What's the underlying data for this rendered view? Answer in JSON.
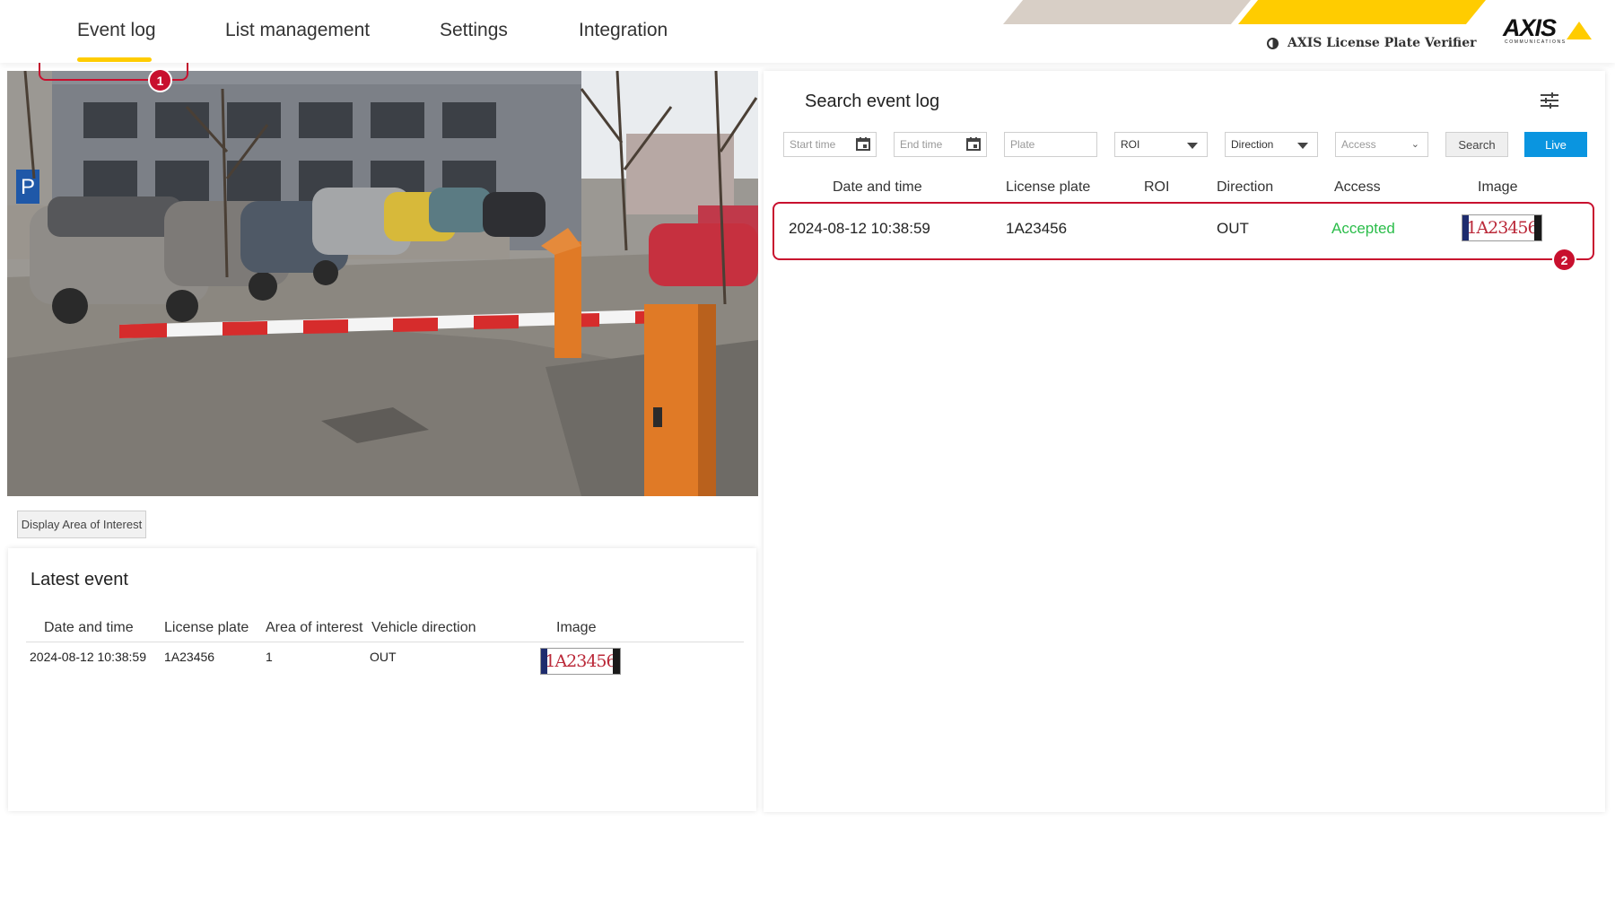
{
  "header": {
    "tabs": [
      {
        "label": "Event log",
        "active": true
      },
      {
        "label": "List management"
      },
      {
        "label": "Settings"
      },
      {
        "label": "Integration"
      }
    ],
    "brand": "AXIS License Plate Verifier",
    "brand_icon": "contrast-icon",
    "logo": {
      "text": "AXIS",
      "subtext": "COMMUNICATIONS"
    },
    "accent_color": "#ffcc00"
  },
  "camera": {
    "area_of_interest_button": "Display Area of Interest"
  },
  "latest_event": {
    "title": "Latest event",
    "columns": [
      "Date and time",
      "License plate",
      "Area of interest",
      "Vehicle direction",
      "Image"
    ],
    "rows": [
      {
        "date_time": "2024-08-12 10:38:59",
        "plate": "1A23456",
        "area": "1",
        "direction": "OUT",
        "image_text": "1A23456"
      }
    ]
  },
  "search": {
    "title": "Search event log",
    "filter_icon": "sliders-icon",
    "start_time_placeholder": "Start time",
    "end_time_placeholder": "End time",
    "plate_placeholder": "Plate",
    "roi_select": "ROI",
    "direction_select": "Direction",
    "access_select": "Access",
    "search_button": "Search",
    "live_button": "Live",
    "live_color": "#0a95e0",
    "columns": [
      "Date and time",
      "License plate",
      "ROI",
      "Direction",
      "Access",
      "Image"
    ],
    "rows": [
      {
        "date_time": "2024-08-12 10:38:59",
        "plate": "1A23456",
        "roi": "",
        "direction": "OUT",
        "access": "Accepted",
        "image_text": "1A23456"
      }
    ],
    "accepted_color": "#2bbd4a"
  },
  "annotations": {
    "badge1": "1",
    "badge2": "2",
    "color": "#c8102e"
  }
}
